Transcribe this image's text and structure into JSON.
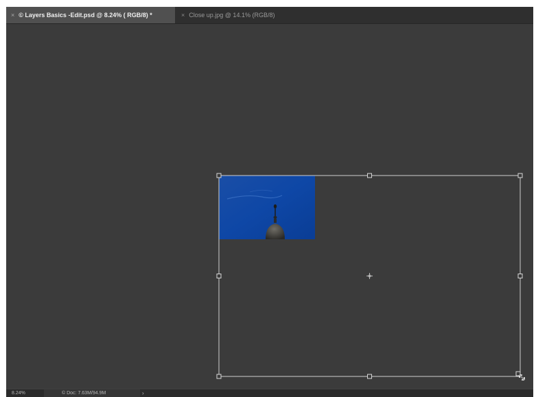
{
  "tabs": [
    {
      "label": "© Layers Basics -Edit.psd @ 8.24% ( RGB/8) *",
      "close": "×",
      "active": true
    },
    {
      "label": "Close up.jpg @ 14.1% (RGB/8)",
      "close": "×",
      "active": false
    }
  ],
  "status": {
    "zoom": "8.24%",
    "doc": "© Doc: 7.63M/94.9M",
    "arrow": "›"
  },
  "icons": {
    "tab_close": "close-icon",
    "transform_center": "crosshair-icon",
    "status_menu": "chevron-right-icon"
  },
  "colors": {
    "canvas_bg": "#3b3b3b",
    "transform_box": "#cfcfcf",
    "sky_top": "#1b4fa8",
    "sky_bottom": "#0a3a8c"
  }
}
